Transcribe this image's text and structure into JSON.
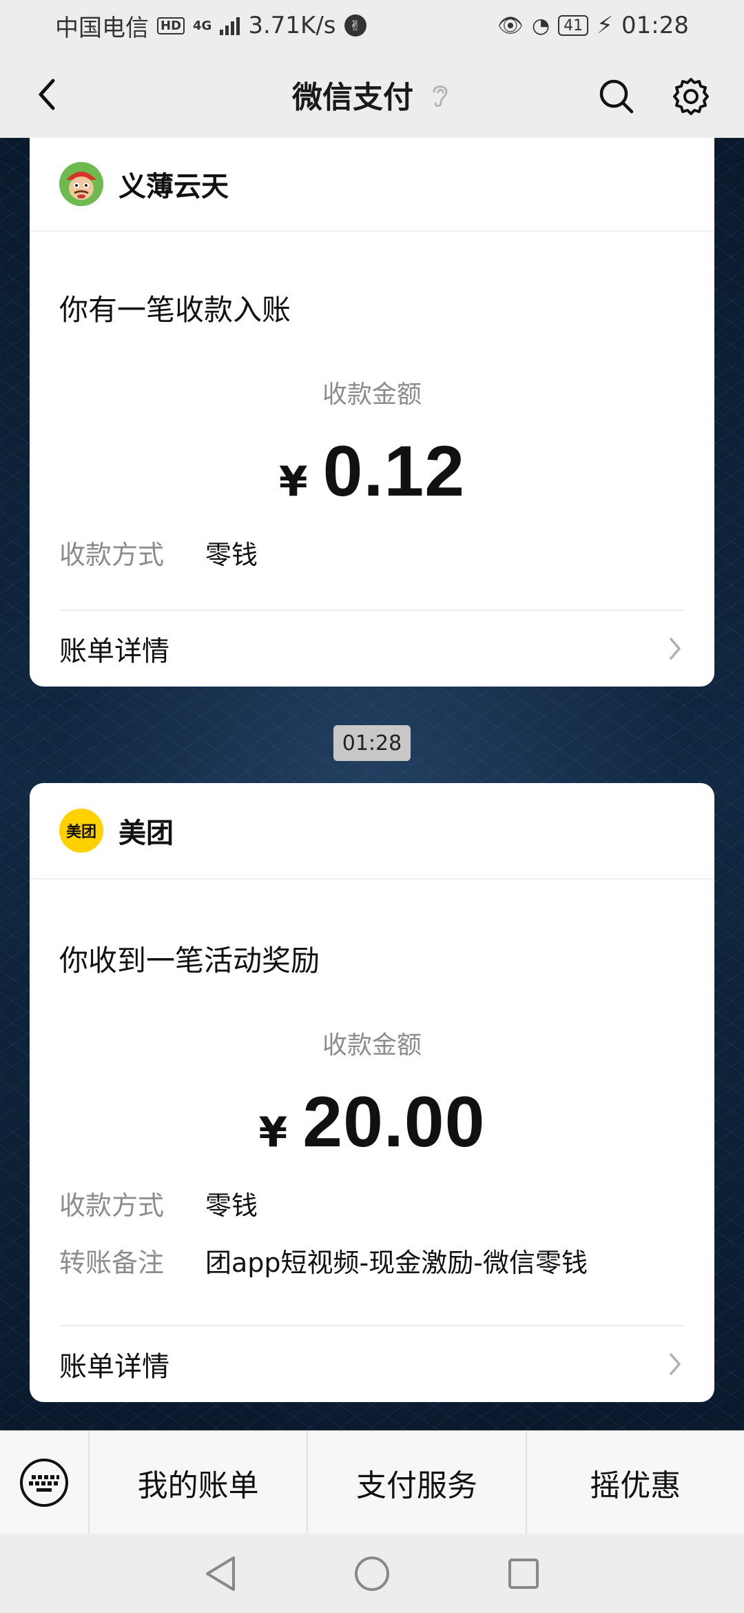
{
  "status_bar": {
    "carrier": "中国电信",
    "hd": "HD",
    "network": "4G",
    "speed": "3.71K/s",
    "battery": "41",
    "time": "01:28"
  },
  "app_bar": {
    "title": "微信支付"
  },
  "messages": [
    {
      "merchant": "义薄云天",
      "notice": "你有一笔收款入账",
      "amount_label": "收款金额",
      "currency": "¥",
      "amount": "0.12",
      "method_key": "收款方式",
      "method_value": "零钱",
      "detail_label": "账单详情"
    },
    {
      "timestamp": "01:28",
      "merchant": "美团",
      "avatar_text": "美团",
      "notice": "你收到一笔活动奖励",
      "amount_label": "收款金额",
      "currency": "¥",
      "amount": "20.00",
      "method_key": "收款方式",
      "method_value": "零钱",
      "remark_key": "转账备注",
      "remark_value": "团app短视频-现金激励-微信零钱",
      "detail_label": "账单详情"
    }
  ],
  "bottom_menu": {
    "items": [
      "我的账单",
      "支付服务",
      "摇优惠"
    ]
  },
  "colors": {
    "card_bg": "#ffffff",
    "header_bg": "#ededed",
    "meituan_yellow": "#ffd100",
    "muted_text": "#8c8c8c"
  }
}
